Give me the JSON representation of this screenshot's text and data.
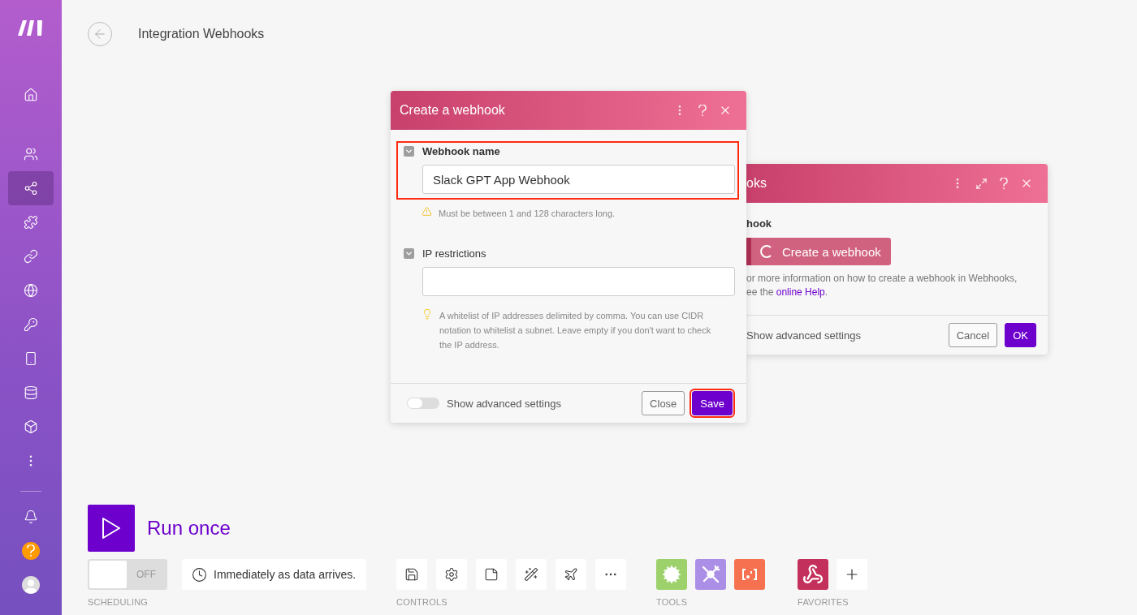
{
  "sidebar": {
    "items": [
      {
        "kind": "home",
        "selected": false
      },
      {
        "kind": "users",
        "selected": false
      },
      {
        "kind": "share",
        "selected": true
      },
      {
        "kind": "puzzle",
        "selected": false
      },
      {
        "kind": "link",
        "selected": false
      },
      {
        "kind": "globe",
        "selected": false
      },
      {
        "kind": "key",
        "selected": false
      },
      {
        "kind": "phone",
        "selected": false
      },
      {
        "kind": "database",
        "selected": false
      },
      {
        "kind": "box",
        "selected": false
      },
      {
        "kind": "more",
        "selected": false
      }
    ],
    "bottom": [
      {
        "kind": "bell"
      },
      {
        "kind": "help"
      },
      {
        "kind": "avatar"
      }
    ]
  },
  "header": {
    "title": "Integration Webhooks"
  },
  "back_dialog": {
    "title": "oks",
    "section_label": "hook",
    "action_button": "Create a webhook",
    "help_lines": [
      [
        {
          "text": "or more information on how to create a webhook in Webhooks,"
        }
      ],
      [
        {
          "text": "ee the "
        },
        {
          "text": "online Help",
          "kind": "link"
        },
        {
          "text": "."
        }
      ]
    ],
    "advanced_label": "Show advanced settings",
    "buttons": [
      {
        "label": "Cancel",
        "primary": false
      },
      {
        "label": "OK",
        "primary": true
      }
    ]
  },
  "dialog": {
    "title": "Create a webhook",
    "fields": [
      {
        "label": "Webhook name",
        "bold": true,
        "expanded": true,
        "value": "Slack GPT App Webhook",
        "highlighted": true,
        "hint": {
          "kind": "warning",
          "text": "Must be between 1 and 128 characters long."
        }
      },
      {
        "label": "IP restrictions",
        "bold": false,
        "expanded": true,
        "highlighted": false,
        "hint": {
          "kind": "tip",
          "text": "A whitelist of IP addresses delimited by comma. You can use CIDR notation to whitelist a subnet. Leave empty if you don't want to check the IP address."
        }
      }
    ],
    "advanced_label": "Show advanced settings",
    "advanced_on": false,
    "buttons": [
      {
        "label": "Close",
        "primary": false,
        "highlighted": false
      },
      {
        "label": "Save",
        "primary": true,
        "highlighted": true
      }
    ]
  },
  "run": {
    "label": "Run once"
  },
  "scheduling": {
    "toggle": {
      "label": "OFF",
      "on": false
    },
    "schedule": "Immediately as data arrives.",
    "caption": "SCHEDULING"
  },
  "controls": {
    "caption": "CONTROLS",
    "items": [
      {
        "kind": "save"
      },
      {
        "kind": "settings"
      },
      {
        "kind": "note"
      },
      {
        "kind": "wand"
      },
      {
        "kind": "plane"
      },
      {
        "kind": "more"
      }
    ]
  },
  "tools": {
    "caption": "TOOLS",
    "items": [
      {
        "kind": "gear",
        "color": "#9dd16b"
      },
      {
        "kind": "wrench",
        "color": "#ab8fe6"
      },
      {
        "kind": "brackets",
        "color": "#f5714f"
      }
    ]
  },
  "favorites": {
    "caption": "FAVORITES",
    "items": [
      {
        "kind": "webhook",
        "color": "#c4305c"
      },
      {
        "kind": "add",
        "color": "#ffffff"
      }
    ]
  }
}
